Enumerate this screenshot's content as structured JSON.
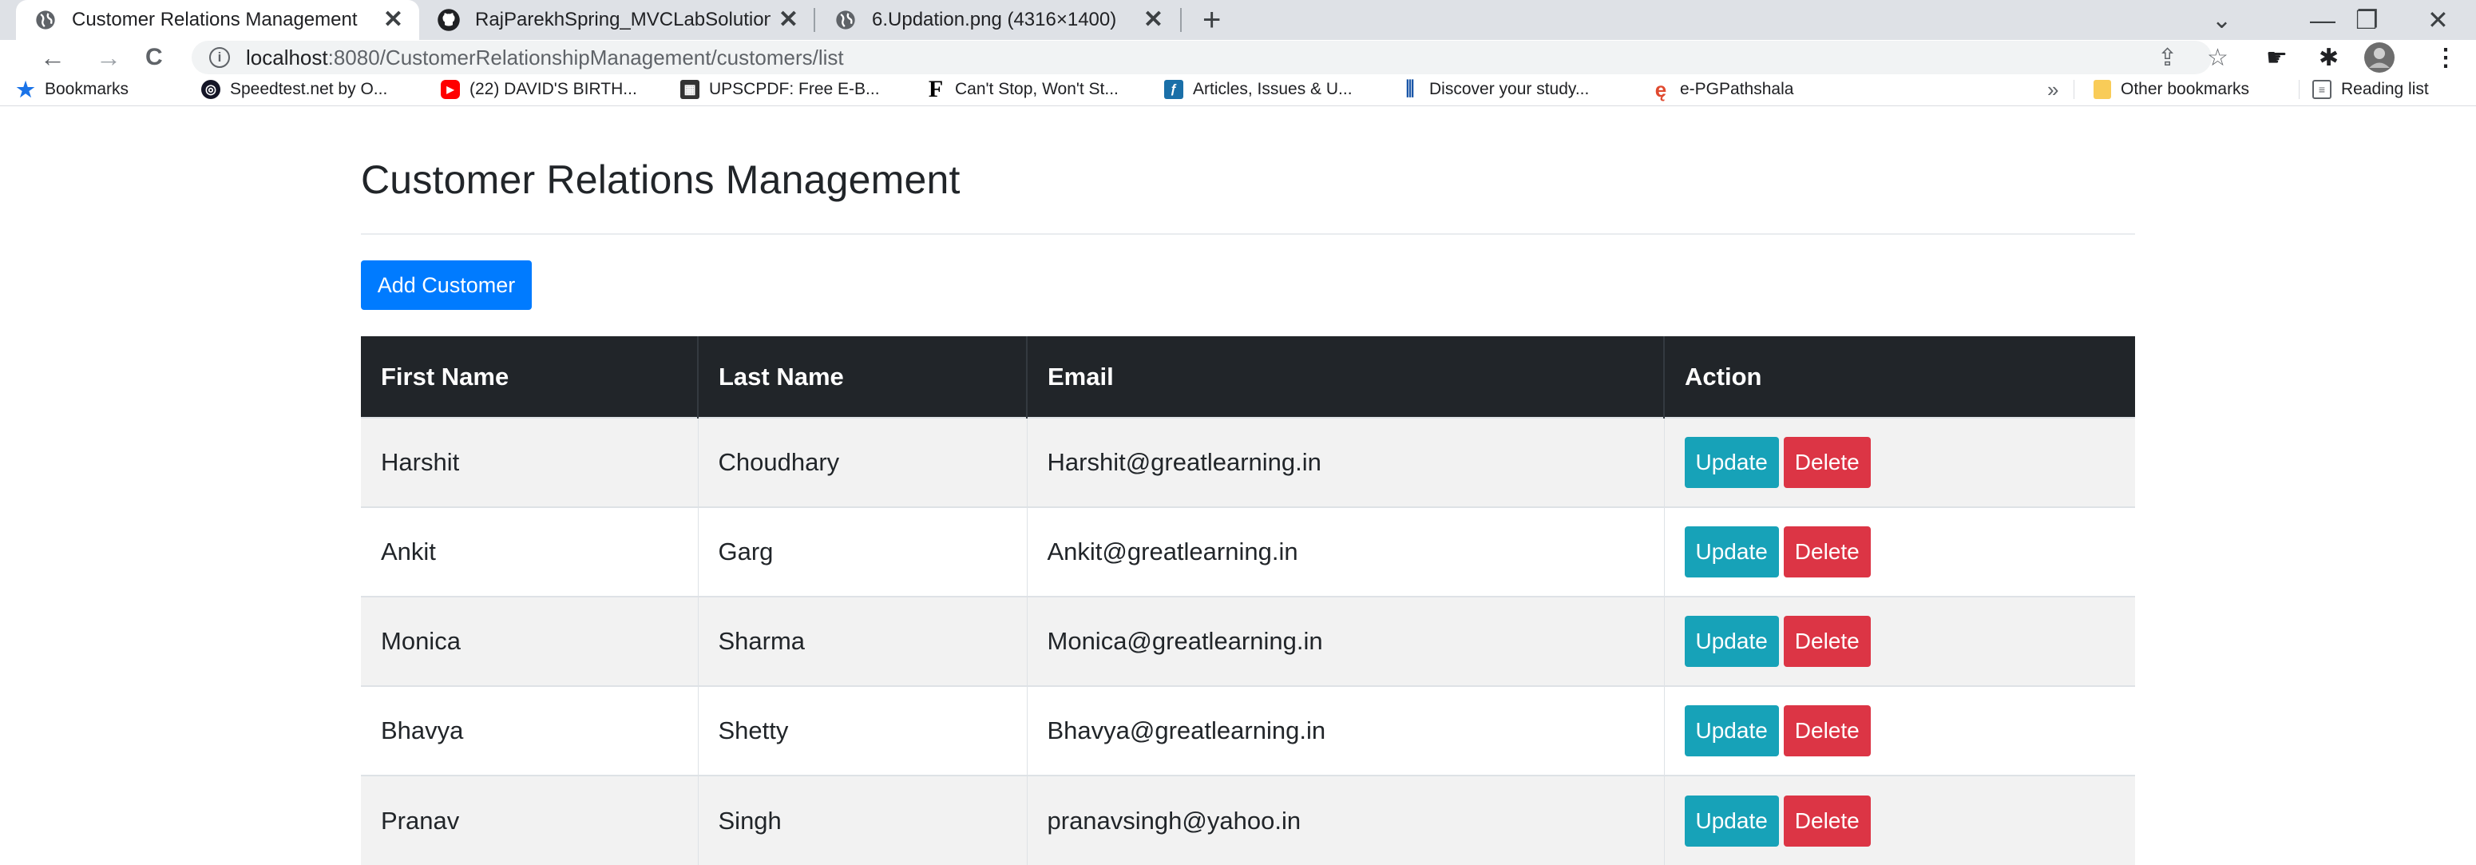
{
  "browser": {
    "tabs": [
      {
        "title": "Customer Relations Management",
        "icon": "globe-icon",
        "active": true
      },
      {
        "title": "RajParekhSpring_MVCLabSolution",
        "icon": "github-icon",
        "active": false
      },
      {
        "title": "6.Updation.png (4316×1400)",
        "icon": "globe-icon",
        "active": false
      }
    ],
    "close_glyph": "✕",
    "new_tab_glyph": "+",
    "window_controls": {
      "dropdown": "⌄",
      "minimize": "—",
      "restore": "❐",
      "close": "✕"
    },
    "nav": {
      "back": "←",
      "forward": "→",
      "reload": "C"
    },
    "address": {
      "host": "localhost",
      "path": ":8080/CustomerRelationshipManagement/customers/list",
      "info_glyph": "i"
    },
    "toolbar_icons": {
      "share": "⇪",
      "star": "☆",
      "extension1": "☛",
      "puzzle": "✱",
      "menu": "⋮"
    },
    "bookmarks": [
      {
        "label": "Bookmarks",
        "icon": "star-icon",
        "color": "#1a73e8"
      },
      {
        "label": "Speedtest.net by O...",
        "icon": "speedtest-icon",
        "color": "#141526"
      },
      {
        "label": "(22) DAVID'S BIRTH...",
        "icon": "youtube-icon",
        "color": "#ff0000"
      },
      {
        "label": "UPSCPDF: Free E-B...",
        "icon": "upscpdf-icon",
        "color": "#333333"
      },
      {
        "label": "Can't Stop, Won't St...",
        "icon": "f-logo-icon",
        "color": "#000000"
      },
      {
        "label": "Articles, Issues & U...",
        "icon": "articles-icon",
        "color": "#1a6fa8"
      },
      {
        "label": "Discover your study...",
        "icon": "discover-icon",
        "color": "#1a56a8"
      },
      {
        "label": "e-PGPathshala",
        "icon": "epg-icon",
        "color": "#e04a2f"
      }
    ],
    "overflow_glyph": "»",
    "other_bookmarks": "Other bookmarks",
    "reading_list": "Reading list",
    "folder_color": "#f9cc58"
  },
  "page": {
    "title": "Customer Relations Management",
    "add_button": "Add Customer",
    "table": {
      "headers": [
        "First Name",
        "Last Name",
        "Email",
        "Action"
      ],
      "rows": [
        {
          "first": "Harshit",
          "last": "Choudhary",
          "email": "Harshit@greatlearning.in"
        },
        {
          "first": "Ankit",
          "last": "Garg",
          "email": "Ankit@greatlearning.in"
        },
        {
          "first": "Monica",
          "last": "Sharma",
          "email": "Monica@greatlearning.in"
        },
        {
          "first": "Bhavya",
          "last": "Shetty",
          "email": "Bhavya@greatlearning.in"
        },
        {
          "first": "Pranav",
          "last": "Singh",
          "email": "pranavsingh@yahoo.in"
        }
      ],
      "update_label": "Update",
      "delete_label": "Delete"
    },
    "colors": {
      "primary": "#007bff",
      "info": "#17a2b8",
      "danger": "#dc3545",
      "dark": "#212529"
    }
  }
}
